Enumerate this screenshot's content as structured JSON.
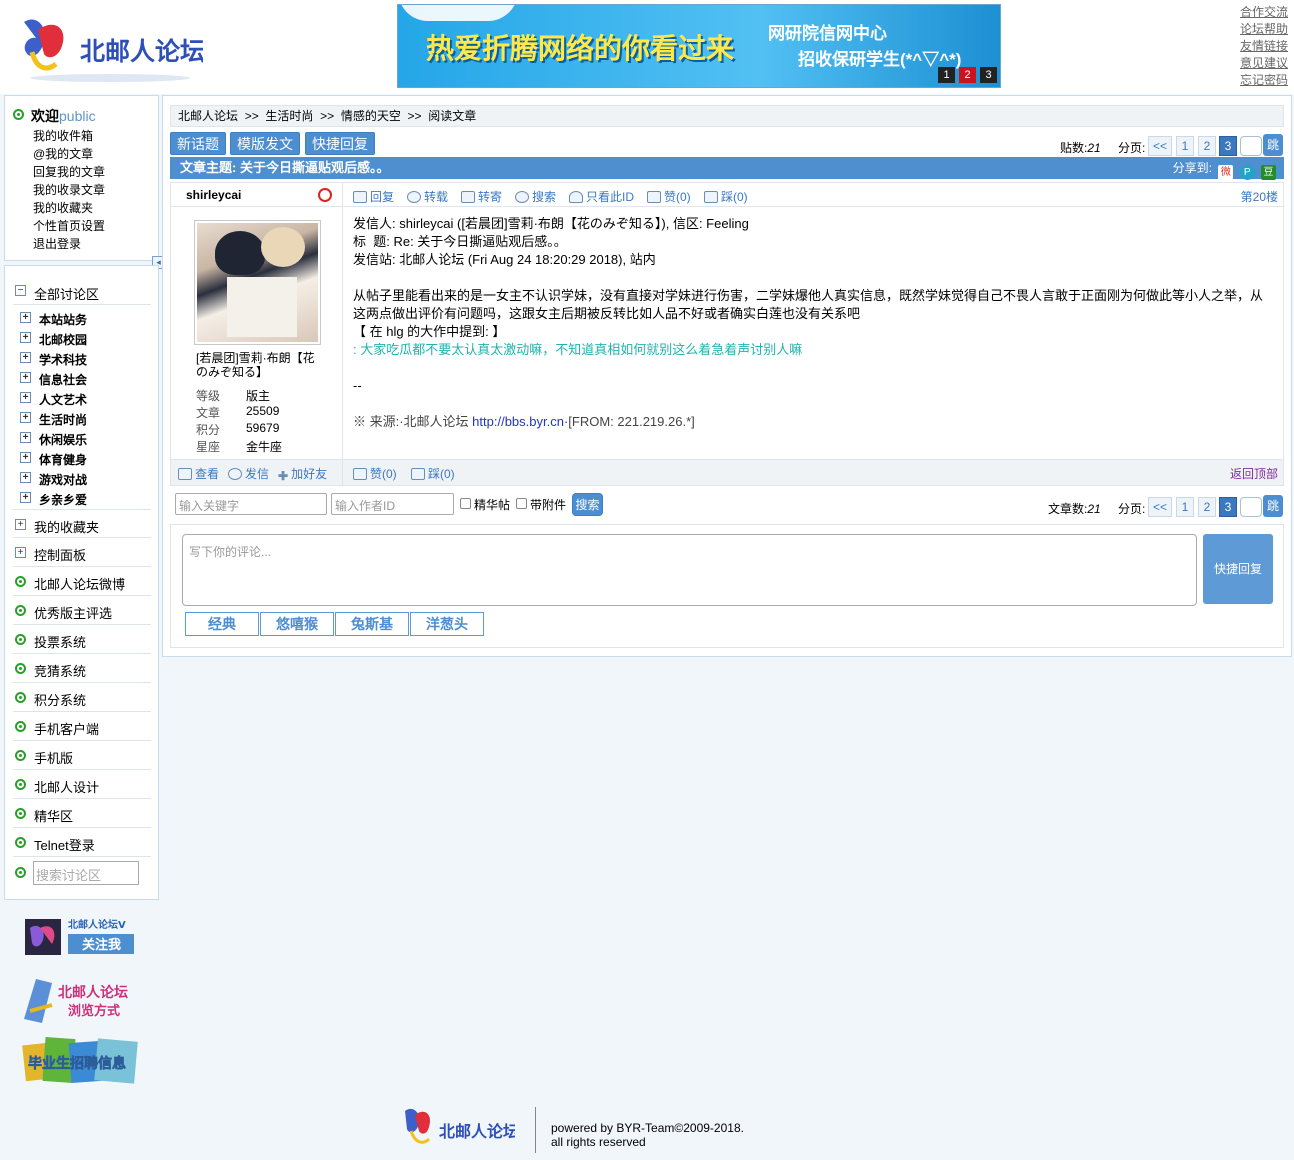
{
  "header": {
    "logo_text": "北邮人论坛",
    "banner_main": "热爱折腾网络的你看过来",
    "banner_line1": "网研院信网中心",
    "banner_line2": "招收保研学生(*^▽^*)",
    "banner_pages": [
      "1",
      "2",
      "3"
    ],
    "links": [
      "合作交流",
      "论坛帮助",
      "友情链接",
      "意见建议",
      "忘记密码"
    ]
  },
  "user": {
    "welcome": "欢迎",
    "name": "public",
    "menu": [
      "我的收件箱",
      "@我的文章",
      "回复我的文章",
      "我的收录文章",
      "我的收藏夹",
      "个性首页设置",
      "退出登录"
    ]
  },
  "nav": {
    "all": "全部讨论区",
    "sections": [
      "本站站务",
      "北邮校园",
      "学术科技",
      "信息社会",
      "人文艺术",
      "生活时尚",
      "休闲娱乐",
      "体育健身",
      "游戏对战",
      "乡亲乡爱"
    ],
    "favorites": "我的收藏夹",
    "control": "控制面板",
    "items": [
      "北邮人论坛微博",
      "优秀版主评选",
      "投票系统",
      "竞猜系统",
      "积分系统",
      "手机客户端",
      "手机版",
      "北邮人设计",
      "精华区",
      "Telnet登录"
    ],
    "search_placeholder": "搜索讨论区"
  },
  "promos": {
    "weibo": "北邮人论坛V",
    "follow": "关注我",
    "browse1": "北邮人论坛",
    "browse2": "浏览方式",
    "jobs": "毕业生招聘信息"
  },
  "breadcrumb": [
    "北邮人论坛",
    "生活时尚",
    "情感的天空",
    "阅读文章"
  ],
  "breadcrumb_sep": ">>",
  "actions": {
    "new": "新话题",
    "template": "模版发文",
    "quick": "快捷回复"
  },
  "pager_top": {
    "count_label": "贴数:",
    "count": "21",
    "page_label": "分页:",
    "prev": "<<",
    "pages": [
      "1",
      "2",
      "3"
    ],
    "go": "跳"
  },
  "title_bar": {
    "label": "文章主题:",
    "title": "关于今日撕逼贴观后感。。",
    "share": "分享到:"
  },
  "post": {
    "author": "shirleycai",
    "author_title": "[若晨团]雪莉·布朗【花のみぞ知る】",
    "stats": [
      {
        "k": "等级",
        "v": "版主"
      },
      {
        "k": "文章",
        "v": "25509"
      },
      {
        "k": "积分",
        "v": "59679"
      },
      {
        "k": "星座",
        "v": "金牛座"
      }
    ],
    "tools": [
      "回复",
      "转载",
      "转寄",
      "搜索",
      "只看此ID",
      "赞(0)",
      "踩(0)"
    ],
    "floor": "第20楼",
    "header_lines": [
      "发信人: shirleycai ([若晨团]雪莉·布朗【花のみぞ知る】), 信区: Feeling",
      "标  题: Re: 关于今日撕逼贴观后感。。",
      "发信站: 北邮人论坛 (Fri Aug 24 18:20:29 2018), 站内"
    ],
    "body": "从帖子里能看出来的是一女主不认识学妹，没有直接对学妹进行伤害，二学妹爆他人真实信息，既然学妹觉得自己不畏人言敢于正面刚为何做此等小人之举，从这两点做出评价有问题吗，这跟女主后期被反转比如人品不好或者确实白莲也没有关系吧",
    "quote_head": "【 在 hlg 的大作中提到: 】",
    "quote": ": 大家吃瓜都不要太认真太激动嘛，不知道真相如何就别这么着急着声讨别人嘛",
    "sig": "--",
    "source_prefix": "※ 来源:·北邮人论坛 ",
    "source_link": "http://bbs.byr.cn",
    "source_suffix": "·[FROM: 221.219.26.*]",
    "left_actions": [
      "查看",
      "发信",
      "加好友"
    ],
    "right_actions": [
      "赞(0)",
      "踩(0)"
    ],
    "back_top": "返回顶部"
  },
  "search_bar": {
    "keyword_placeholder": "输入关键字",
    "author_placeholder": "输入作者ID",
    "digest": "精华帖",
    "attach": "带附件",
    "button": "搜索",
    "count_label": "文章数:",
    "count": "21"
  },
  "reply": {
    "placeholder": "写下你的评论...",
    "button": "快捷回复",
    "tags": [
      "经典",
      "悠嘻猴",
      "兔斯基",
      "洋葱头"
    ]
  },
  "footer": {
    "logo_text": "北邮人论坛",
    "line1": "powered by BYR-Team©2009-2018.",
    "line2": "all rights reserved"
  }
}
